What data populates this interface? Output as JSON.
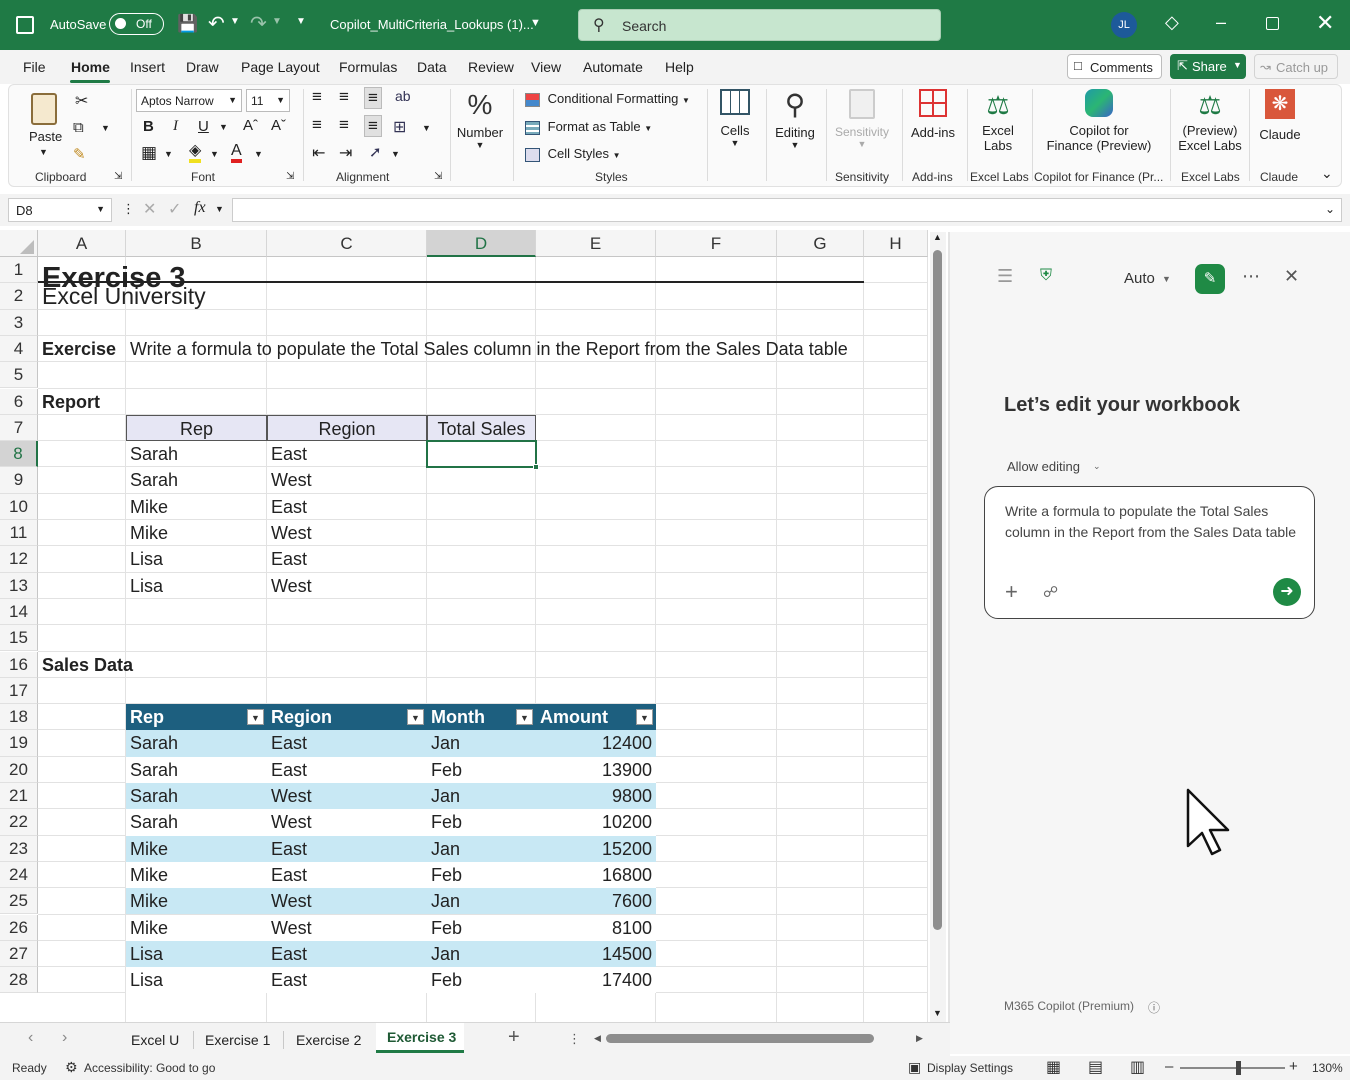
{
  "titlebar": {
    "autosave_label": "AutoSave",
    "autosave_state": "Off",
    "filename": "Copilot_MultiCriteria_Lookups (1)...",
    "search_placeholder": "Search",
    "user_initials": "JL"
  },
  "menu": {
    "tabs": [
      "File",
      "Home",
      "Insert",
      "Draw",
      "Page Layout",
      "Formulas",
      "Data",
      "Review",
      "View",
      "Automate",
      "Help"
    ],
    "active_tab": "Home",
    "comments_label": "Comments",
    "share_label": "Share",
    "catchup_label": "Catch up"
  },
  "ribbon": {
    "clipboard": {
      "paste": "Paste",
      "label": "Clipboard"
    },
    "font": {
      "name": "Aptos Narrow",
      "size": "11",
      "label": "Font",
      "bold": "B",
      "italic": "I",
      "underline": "U"
    },
    "alignment": {
      "label": "Alignment"
    },
    "number": {
      "label": "Number"
    },
    "styles": {
      "conditional": "Conditional Formatting",
      "format_table": "Format as Table",
      "cell_styles": "Cell Styles",
      "label": "Styles"
    },
    "cells": {
      "label": "Cells"
    },
    "editing": {
      "label": "Editing"
    },
    "sensitivity": {
      "button": "Sensitivity",
      "label": "Sensitivity"
    },
    "addins": {
      "button": "Add-ins",
      "label": "Add-ins"
    },
    "excel_labs": {
      "button_line1": "Excel",
      "button_line2": "Labs",
      "label": "Excel Labs"
    },
    "copilot_finance": {
      "button_line1": "Copilot for",
      "button_line2": "Finance (Preview)",
      "label": "Copilot for Finance (Pr..."
    },
    "preview_labs": {
      "button_line1": "(Preview)",
      "button_line2": "Excel Labs",
      "label": "Excel Labs"
    },
    "claude": {
      "button": "Claude",
      "label": "Claude"
    }
  },
  "formula_bar": {
    "name_box": "D8",
    "fx": "fx",
    "value": ""
  },
  "grid": {
    "columns": [
      "A",
      "B",
      "C",
      "D",
      "E",
      "F",
      "G",
      "H"
    ],
    "selected_column": "D",
    "rows": [
      "1",
      "2",
      "3",
      "4",
      "5",
      "6",
      "7",
      "8",
      "9",
      "10",
      "11",
      "12",
      "13",
      "14",
      "15",
      "16",
      "17",
      "18",
      "19",
      "20",
      "21",
      "22",
      "23",
      "24",
      "25",
      "26",
      "27",
      "28"
    ],
    "selected_row": "8",
    "title": "Exercise 3",
    "subtitle": "Excel University",
    "exercise_label": "Exercise",
    "exercise_text": "Write a formula to populate the Total Sales column in the Report from the Sales Data table",
    "report_label": "Report",
    "report_headers": [
      "Rep",
      "Region",
      "Total Sales"
    ],
    "report_rows": [
      [
        "Sarah",
        "East"
      ],
      [
        "Sarah",
        "West"
      ],
      [
        "Mike",
        "East"
      ],
      [
        "Mike",
        "West"
      ],
      [
        "Lisa",
        "East"
      ],
      [
        "Lisa",
        "West"
      ]
    ],
    "sales_label": "Sales Data",
    "sales_headers": [
      "Rep",
      "Region",
      "Month",
      "Amount"
    ],
    "sales_rows": [
      [
        "Sarah",
        "East",
        "Jan",
        "12400"
      ],
      [
        "Sarah",
        "East",
        "Feb",
        "13900"
      ],
      [
        "Sarah",
        "West",
        "Jan",
        "9800"
      ],
      [
        "Sarah",
        "West",
        "Feb",
        "10200"
      ],
      [
        "Mike",
        "East",
        "Jan",
        "15200"
      ],
      [
        "Mike",
        "East",
        "Feb",
        "16800"
      ],
      [
        "Mike",
        "West",
        "Jan",
        "7600"
      ],
      [
        "Mike",
        "West",
        "Feb",
        "8100"
      ],
      [
        "Lisa",
        "East",
        "Jan",
        "14500"
      ],
      [
        "Lisa",
        "East",
        "Feb",
        "17400"
      ]
    ]
  },
  "copilot": {
    "mode": "Auto",
    "heading": "Let’s edit your workbook",
    "allow_editing": "Allow editing",
    "prompt_text": "Write a formula to populate the Total Sales column in the Report from the Sales Data table",
    "footer": "M365 Copilot (Premium)"
  },
  "sheets": {
    "tabs": [
      "Excel U",
      "Exercise 1",
      "Exercise 2",
      "Exercise 3"
    ],
    "active": "Exercise 3"
  },
  "status": {
    "ready": "Ready",
    "accessibility": "Accessibility: Good to go",
    "display_settings": "Display Settings",
    "zoom": "130%"
  },
  "colors": {
    "title_green": "#1f7a45",
    "table_header": "#1d5f7f",
    "table_band": "#c8e8f4",
    "report_header": "#e6e6f4",
    "copilot_green": "#1f8a45"
  }
}
